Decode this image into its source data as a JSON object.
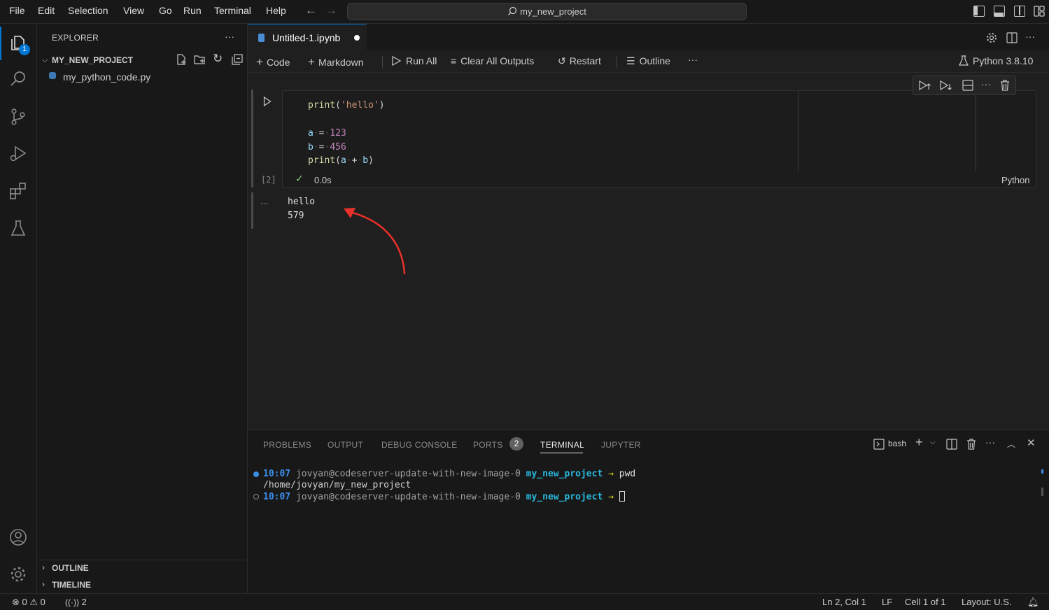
{
  "menu": [
    "File",
    "Edit",
    "Selection",
    "View",
    "Go",
    "Run",
    "Terminal",
    "Help"
  ],
  "command_center": {
    "text": "my_new_project"
  },
  "activity": {
    "explorer_badge": "1"
  },
  "sidebar": {
    "title": "EXPLORER",
    "project": "MY_NEW_PROJECT",
    "file": "my_python_code.py",
    "outline": "OUTLINE",
    "timeline": "TIMELINE"
  },
  "editor": {
    "tab_label": "Untitled-1.ipynb",
    "toolbar": {
      "code": "Code",
      "markdown": "Markdown",
      "run_all": "Run All",
      "clear_outputs": "Clear All Outputs",
      "restart": "Restart",
      "outline": "Outline",
      "kernel": "Python 3.8.10"
    },
    "cell": {
      "exec_count": "[2]",
      "duration": "0.0s",
      "language": "Python",
      "code": {
        "l1_fn": "print",
        "l1_open": "(",
        "l1_str": "'hello'",
        "l1_close": ")",
        "l3_var": "a",
        "l3_op": "=",
        "l3_num": "123",
        "l4_var": "b",
        "l4_op": "=",
        "l4_num": "456",
        "l5_fn": "print",
        "l5_open": "(",
        "l5_a": "a",
        "l5_op": "+",
        "l5_b": "b",
        "l5_close": ")"
      },
      "output_more": "...",
      "output": [
        "hello",
        "579"
      ]
    }
  },
  "panel": {
    "tabs": [
      "PROBLEMS",
      "OUTPUT",
      "DEBUG CONSOLE",
      "PORTS",
      "TERMINAL",
      "JUPYTER"
    ],
    "ports_badge": "2",
    "shell": "bash",
    "terminal": {
      "time1": "10:07",
      "host": "jovyan@codeserver-update-with-new-image-0",
      "dir": "my_new_project",
      "arrow": "→",
      "cmd1": "pwd",
      "out1": "/home/jovyan/my_new_project",
      "time2": "10:07"
    }
  },
  "status": {
    "errors": "0",
    "warnings": "0",
    "ports": "2",
    "position": "Ln 2, Col 1",
    "eol": "LF",
    "cell": "Cell 1 of 1",
    "layout": "Layout: U.S."
  },
  "colors": {
    "accent": "#0078d4",
    "arrow": "#e8302a",
    "string": "#ce9178",
    "number": "#c586c0",
    "function": "#dcdcaa",
    "variable": "#9cdcfe"
  }
}
